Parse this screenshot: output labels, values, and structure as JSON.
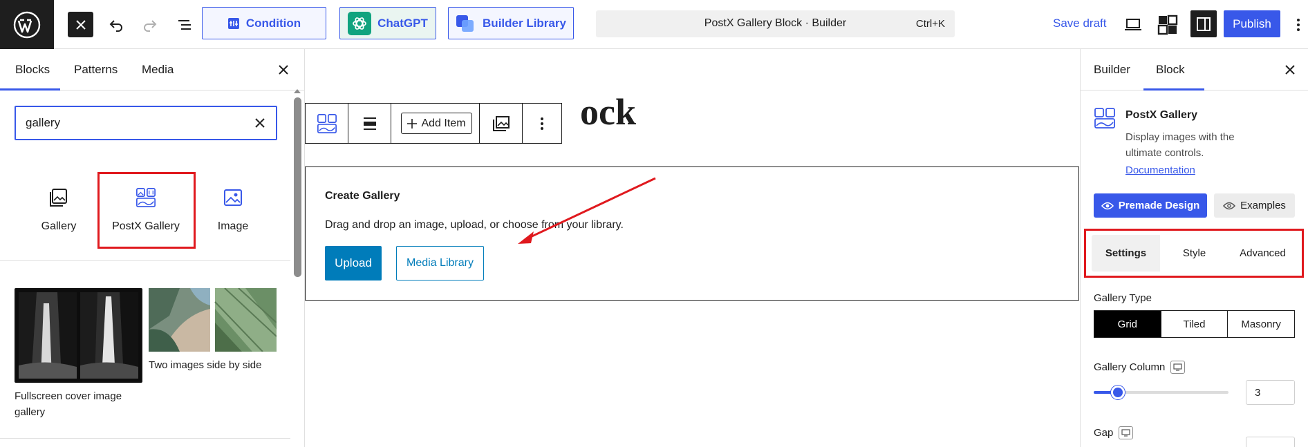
{
  "toolbar": {
    "condition_label": "Condition",
    "chatgpt_label": "ChatGPT",
    "builder_library_label": "Builder Library",
    "command_title": "PostX Gallery Block · Builder",
    "command_shortcut": "Ctrl+K",
    "save_draft_label": "Save draft",
    "publish_label": "Publish"
  },
  "inserter": {
    "tabs": [
      "Blocks",
      "Patterns",
      "Media"
    ],
    "active_tab": "Blocks",
    "search_value": "gallery",
    "blocks": [
      {
        "label": "Gallery",
        "icon": "gallery-icon"
      },
      {
        "label": "PostX Gallery",
        "icon": "postx-gallery-icon"
      },
      {
        "label": "Image",
        "icon": "image-icon"
      }
    ],
    "patterns": [
      {
        "caption": "Fullscreen cover image gallery"
      },
      {
        "caption": "Two images side by side"
      }
    ]
  },
  "canvas": {
    "title_partial": "ock",
    "toolbar": {
      "add_item_label": "Add Item"
    },
    "placeholder": {
      "title": "Create Gallery",
      "instructions": "Drag and drop an image, upload, or choose from your library.",
      "upload_label": "Upload",
      "media_library_label": "Media Library"
    }
  },
  "sidebar": {
    "tabs": [
      "Builder",
      "Block"
    ],
    "active_tab": "Block",
    "block_card": {
      "title": "PostX Gallery",
      "description": "Display images with the ultimate controls.",
      "documentation_label": "Documentation"
    },
    "premade_design_label": "Premade Design",
    "examples_label": "Examples",
    "settings_tabs": [
      "Settings",
      "Style",
      "Advanced"
    ],
    "active_settings_tab": "Settings",
    "gallery_type": {
      "label": "Gallery Type",
      "options": [
        "Grid",
        "Tiled",
        "Masonry"
      ],
      "selected": "Grid"
    },
    "gallery_column": {
      "label": "Gallery Column",
      "value": "3",
      "slider_fraction": 0.18
    },
    "gap": {
      "label": "Gap"
    }
  },
  "colors": {
    "accent": "#3858e9",
    "highlight_red": "#e0191e",
    "wp_button": "#007cba",
    "dark": "#1e1e1e"
  }
}
